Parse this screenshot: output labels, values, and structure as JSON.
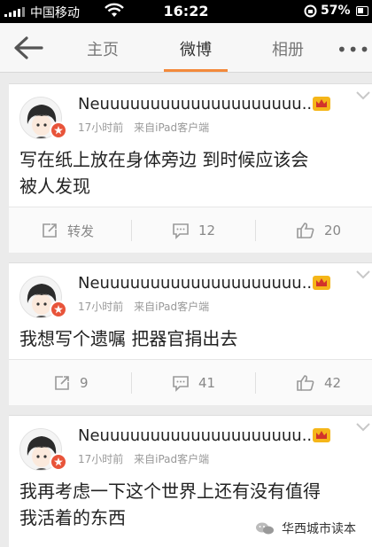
{
  "status_bar": {
    "carrier": "中国移动",
    "time": "16:22",
    "battery_text": "57%",
    "battery_level": 0.57,
    "signal_icon": "signal-bars-icon",
    "wifi_icon": "wifi-icon",
    "lock_icon": "rotation-lock-icon"
  },
  "nav": {
    "back_icon": "back-arrow-icon",
    "tabs": [
      {
        "label": "主页",
        "active": false
      },
      {
        "label": "微博",
        "active": true
      },
      {
        "label": "相册",
        "active": false
      }
    ],
    "more_label": "•••",
    "accent_color": "#f3893b"
  },
  "posts": [
    {
      "username": "Neuuuuuuuuuuuuuuuuuuuu...",
      "time": "17小时前",
      "source": "来自iPad客户端",
      "text_lines": [
        "写在纸上放在身体旁边 到时候应该会",
        "被人发现"
      ],
      "repost_label": "转发",
      "comments": "12",
      "likes": "20"
    },
    {
      "username": "Neuuuuuuuuuuuuuuuuuuuu...",
      "time": "17小时前",
      "source": "来自iPad客户端",
      "text_lines": [
        "我想写个遗嘱 把器官捐出去"
      ],
      "repost_label": "9",
      "comments": "41",
      "likes": "42"
    },
    {
      "username": "Neuuuuuuuuuuuuuuuuuuuu...",
      "time": "17小时前",
      "source": "来自iPad客户端",
      "text_lines": [
        "我再考虑一下这个世界上还有没有值得",
        "我活着的东西"
      ]
    }
  ],
  "watermark": {
    "text": "华西城市读本",
    "icon": "wechat-icon"
  }
}
